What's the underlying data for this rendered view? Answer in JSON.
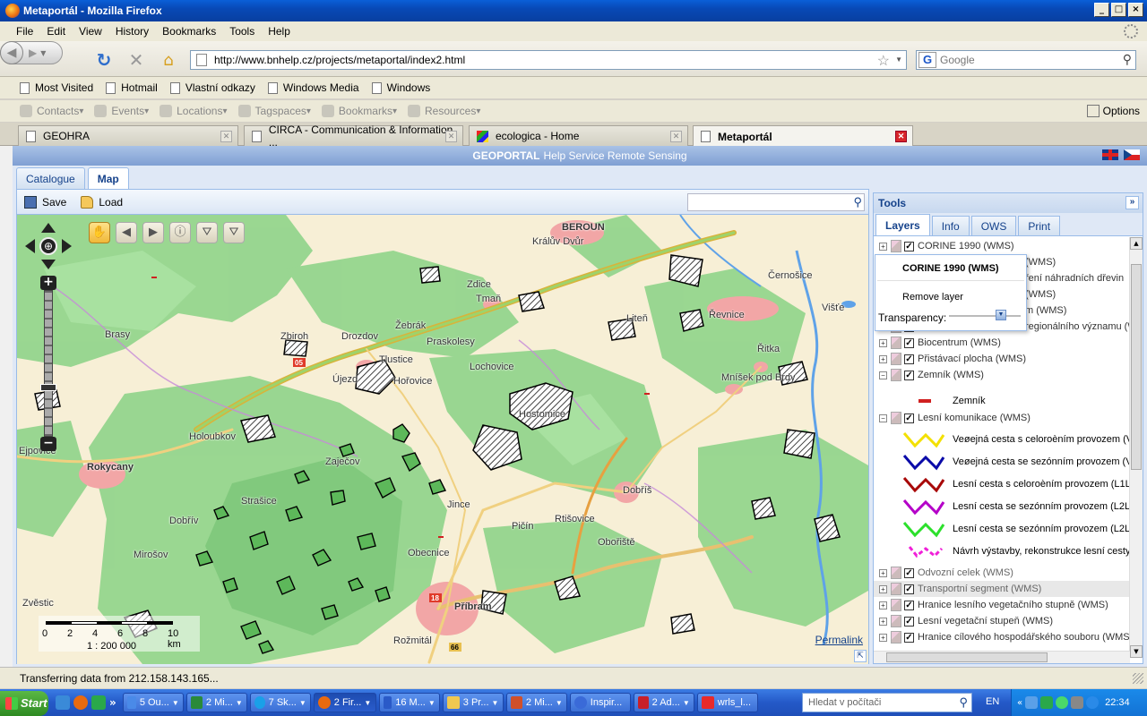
{
  "window": {
    "title": "Metaportál - Mozilla Firefox",
    "buttons": [
      "_",
      "□",
      "×"
    ]
  },
  "menu": [
    "File",
    "Edit",
    "View",
    "History",
    "Bookmarks",
    "Tools",
    "Help"
  ],
  "nav": {
    "url": "http://www.bnhelp.cz/projects/metaportal/index2.html",
    "search_placeholder": "Google",
    "search_engine_letter": "G"
  },
  "bookmarks": [
    "Most Visited",
    "Hotmail",
    "Vlastní odkazy",
    "Windows Media",
    "Windows"
  ],
  "extensions": [
    "Contacts",
    "Events",
    "Locations",
    "Tagspaces",
    "Bookmarks",
    "Resources"
  ],
  "extensions_options": "Options",
  "tabs": [
    {
      "label": "GEOHRA"
    },
    {
      "label": "CIRCA - Communication & Information ..."
    },
    {
      "label": "ecologica - Home"
    },
    {
      "label": "Metaportál"
    }
  ],
  "geoportal": {
    "brand": "GEOPORTAL",
    "subtitle": "Help Service Remote Sensing"
  },
  "main_tabs": [
    "Catalogue",
    "Map"
  ],
  "map_toolbar": {
    "save": "Save",
    "load": "Load"
  },
  "map": {
    "labels": [
      "BEROUN",
      "Králův Dvůr",
      "Zdice",
      "Tmaň",
      "Liteň",
      "Černošice",
      "Řevnice",
      "Brasy",
      "Zbiroh",
      "Žebrák",
      "Drozdov",
      "Praskolesy",
      "Tlustice",
      "Hořovice",
      "Lochovice",
      "Újezd",
      "Hostomice",
      "Dobříš",
      "Mníšek pod Brdy",
      "Rokycany",
      "Holoubkov",
      "Zaječov",
      "Strašice",
      "Dobřív",
      "Mirošov",
      "Příbram",
      "Obecnice",
      "Obořiště",
      "Rožmitál",
      "Rtišovice",
      "Ejpovice",
      "Zvěstic",
      "Višťe",
      "Řitka",
      "Pičín",
      "Jince"
    ],
    "scale_ticks": [
      "0",
      "2",
      "4",
      "6",
      "8",
      "10 km"
    ],
    "scale_ratio": "1 : 200 000",
    "permalink": "Permalink",
    "pan_center": "⊕",
    "zoom_in": "+",
    "zoom_out": "−"
  },
  "tools": {
    "title": "Tools",
    "tabs": [
      "Layers",
      "Info",
      "OWS",
      "Print"
    ],
    "layers": [
      {
        "name": "CORINE 1990 (WMS)",
        "checked": true,
        "expander": "+"
      },
      {
        "name": "(WMS)",
        "checked": true,
        "expander": "+"
      },
      {
        "name": "ření náhradních dřevin",
        "checked": true,
        "expander": "+"
      },
      {
        "name": "(WMS)",
        "checked": true,
        "expander": "+"
      },
      {
        "name": "m (WMS)",
        "checked": true,
        "expander": "+"
      },
      {
        "name": "regionálního významu (W",
        "checked": true,
        "expander": "+"
      },
      {
        "name": "Biocentrum (WMS)",
        "checked": true,
        "expander": "+"
      },
      {
        "name": "Přistávací plocha (WMS)",
        "checked": true,
        "expander": "+"
      },
      {
        "name": "Zemník (WMS)",
        "checked": true,
        "expander": "−"
      }
    ],
    "zemnik_legend": "Zemník",
    "lesni_layer": {
      "name": "Lesní komunikace (WMS)",
      "expander": "−"
    },
    "lesni_legend": [
      {
        "label": "Veøejná cesta s celoroèním provozem (V1",
        "color": "#f3e000"
      },
      {
        "label": "Veøejná cesta se sezónním provozem (V2",
        "color": "#0a0aa8"
      },
      {
        "label": "Lesní cesta s celoroèním provozem (L1L)",
        "color": "#a80808"
      },
      {
        "label": "Lesní cesta se sezónním provozem (L2L)",
        "color": "#b400c8"
      },
      {
        "label": "Lesní cesta se sezónním provozem (L2L)",
        "color": "#2ce02c"
      },
      {
        "label": "Návrh výstavby, rekonstrukce lesní cesty",
        "color": "#f020d8"
      }
    ],
    "layers_after": [
      {
        "name": "Odvozní celek (WMS)",
        "expander": "+"
      },
      {
        "name": "Transportní segment (WMS)",
        "expander": "+"
      },
      {
        "name": "Hranice lesního vegetačního stupně (WMS)",
        "expander": "+"
      },
      {
        "name": "Lesní vegetační stupeň (WMS)",
        "expander": "+"
      },
      {
        "name": "Hranice cílového hospodářského souboru (WMS",
        "expander": "+"
      }
    ],
    "popup": {
      "title": "CORINE 1990 (WMS)",
      "remove": "Remove layer",
      "transparency": "Transparency:"
    }
  },
  "status": "Transferring data from 212.158.143.165...",
  "taskbar": {
    "start": "Start",
    "tasks": [
      {
        "label": "5 Ou...",
        "active": false
      },
      {
        "label": "2 Mi...",
        "active": false
      },
      {
        "label": "7 Sk...",
        "active": false
      },
      {
        "label": "2 Fir...",
        "active": true
      },
      {
        "label": "16 M...",
        "active": false
      },
      {
        "label": "3 Pr...",
        "active": false
      },
      {
        "label": "2 Mi...",
        "active": false
      },
      {
        "label": "Inspir...",
        "active": false
      },
      {
        "label": "2 Ad...",
        "active": false
      },
      {
        "label": "wrls_l...",
        "active": false
      }
    ],
    "search_placeholder": "Hledat v počítači",
    "lang": "EN",
    "clock": "22:34"
  }
}
